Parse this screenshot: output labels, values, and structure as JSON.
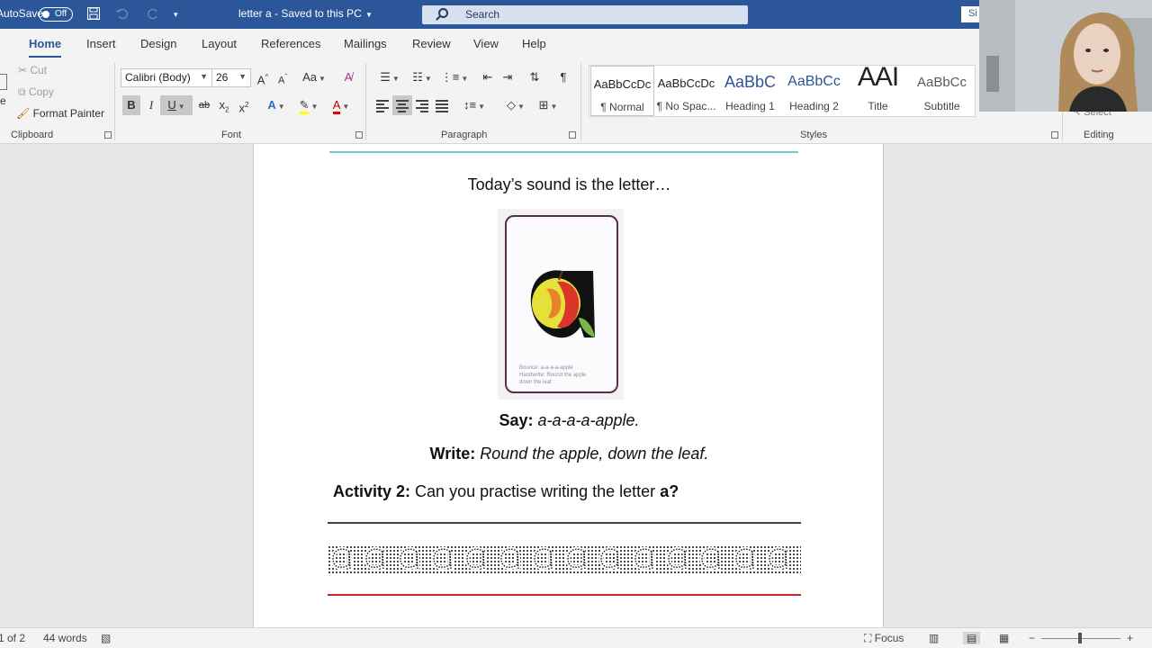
{
  "titlebar": {
    "autosave_label": "AutoSave",
    "autosave_toggle": "Off",
    "doc_title": "letter a  -  Saved to this PC",
    "search_placeholder": "Search",
    "signin_label": "Si"
  },
  "tabs": [
    "Home",
    "Insert",
    "Design",
    "Layout",
    "References",
    "Mailings",
    "Review",
    "View",
    "Help"
  ],
  "active_tab": "Home",
  "clipboard": {
    "paste_label": "e",
    "cut": "Cut",
    "copy": "Copy",
    "format_painter": "Format Painter",
    "group_label": "Clipboard"
  },
  "font": {
    "family": "Calibri (Body)",
    "size": "26",
    "grow": "A",
    "shrink": "A",
    "change_case": "Aa",
    "bold": "B",
    "italic": "I",
    "underline": "U",
    "strike": "ab",
    "subscript": "x",
    "superscript": "x",
    "text_effects": "A",
    "font_color": "A",
    "group_label": "Font"
  },
  "paragraph": {
    "group_label": "Paragraph",
    "pilcrow": "¶"
  },
  "styles": {
    "group_label": "Styles",
    "items": [
      {
        "preview": "AaBbCcDc",
        "name": "¶ Normal"
      },
      {
        "preview": "AaBbCcDc",
        "name": "¶ No Spac..."
      },
      {
        "preview": "AaBbC",
        "name": "Heading 1"
      },
      {
        "preview": "AaBbCc",
        "name": "Heading 2"
      },
      {
        "preview": "AAI",
        "name": "Title"
      },
      {
        "preview": "AaBbCc",
        "name": "Subtitle"
      }
    ]
  },
  "editing": {
    "group_label": "Editing",
    "select_label": "Select"
  },
  "document": {
    "heading": "Today’s sound is the letter…",
    "card_caption": [
      "Bounce: a-a-a-a-apple",
      "Handwrite: Round the apple",
      "down the leaf"
    ],
    "say_label": "Say:",
    "say_text": "a-a-a-a-apple.",
    "write_label": "Write:",
    "write_text": "Round the apple, down the leaf.",
    "activity_label": "Activity 2:",
    "activity_text": "Can you practise writing the letter",
    "activity_letter": "a?"
  },
  "status": {
    "page": "1 of 2",
    "words": "44 words",
    "focus": "Focus"
  },
  "colors": {
    "brand": "#2b579a",
    "card_border": "#5b2b4d",
    "red_line": "#c0292a",
    "blue_rule": "#7bc4d8"
  }
}
